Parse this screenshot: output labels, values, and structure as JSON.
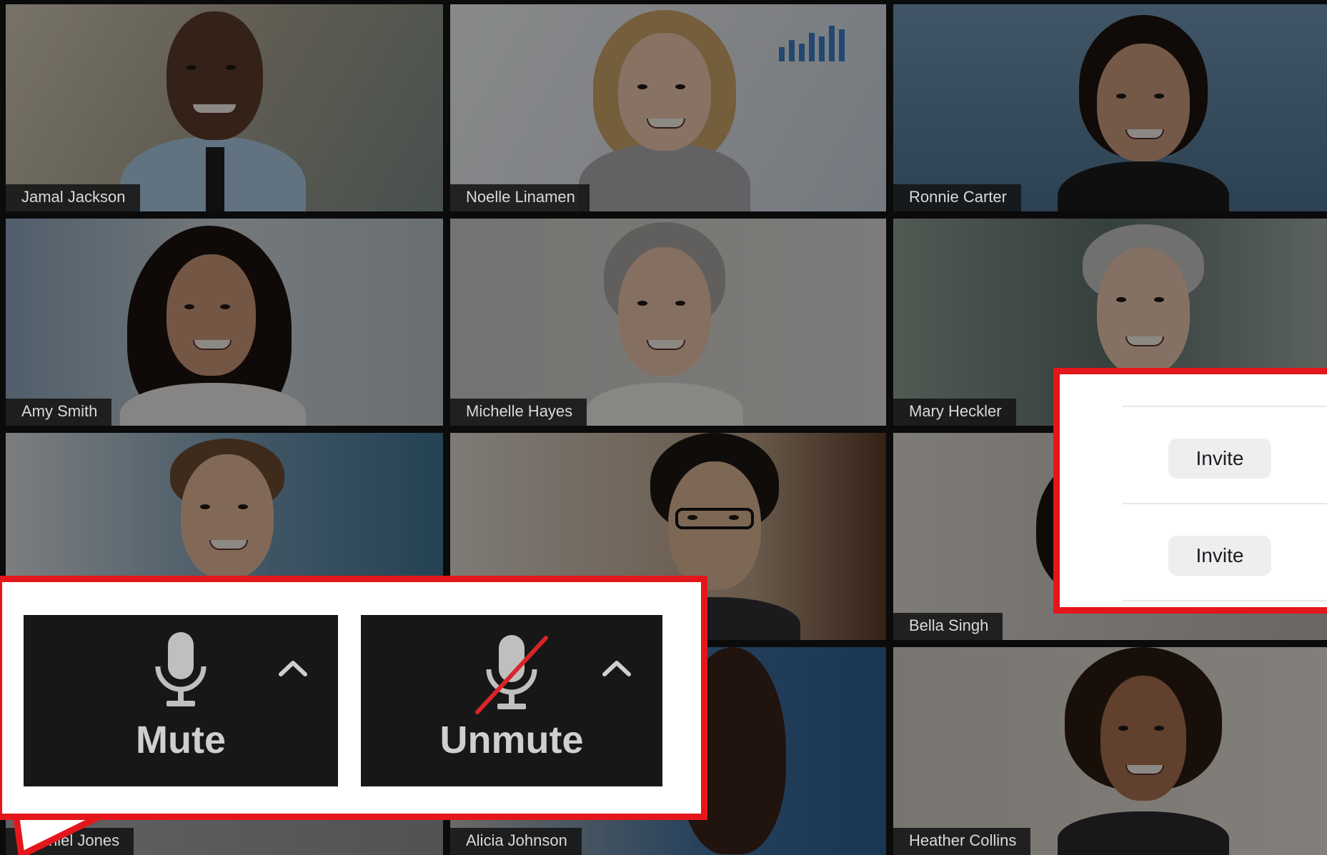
{
  "participants": [
    {
      "name": "Jamal Jackson"
    },
    {
      "name": "Noelle Linamen"
    },
    {
      "name": "Ronnie Carter"
    },
    {
      "name": "Amy Smith"
    },
    {
      "name": "Michelle Hayes"
    },
    {
      "name": "Mary Heckler"
    },
    {
      "name": "Bella Singh"
    },
    {
      "name": "Heather Collins"
    },
    {
      "name": "Alicia Johnson"
    },
    {
      "name": "niel Jones"
    }
  ],
  "audio_controls": {
    "mute_label": "Mute",
    "unmute_label": "Unmute"
  },
  "invite_panel": {
    "rows": [
      {
        "button_label": "Invite"
      },
      {
        "button_label": "Invite"
      }
    ]
  },
  "colors": {
    "callout_border": "#e3171b",
    "control_bg": "#171717",
    "control_text": "#cfcfcf",
    "mute_slash": "#d8242a"
  },
  "icons": {
    "mute": "microphone-icon",
    "unmute": "microphone-off-icon",
    "options": "chevron-up-icon"
  }
}
